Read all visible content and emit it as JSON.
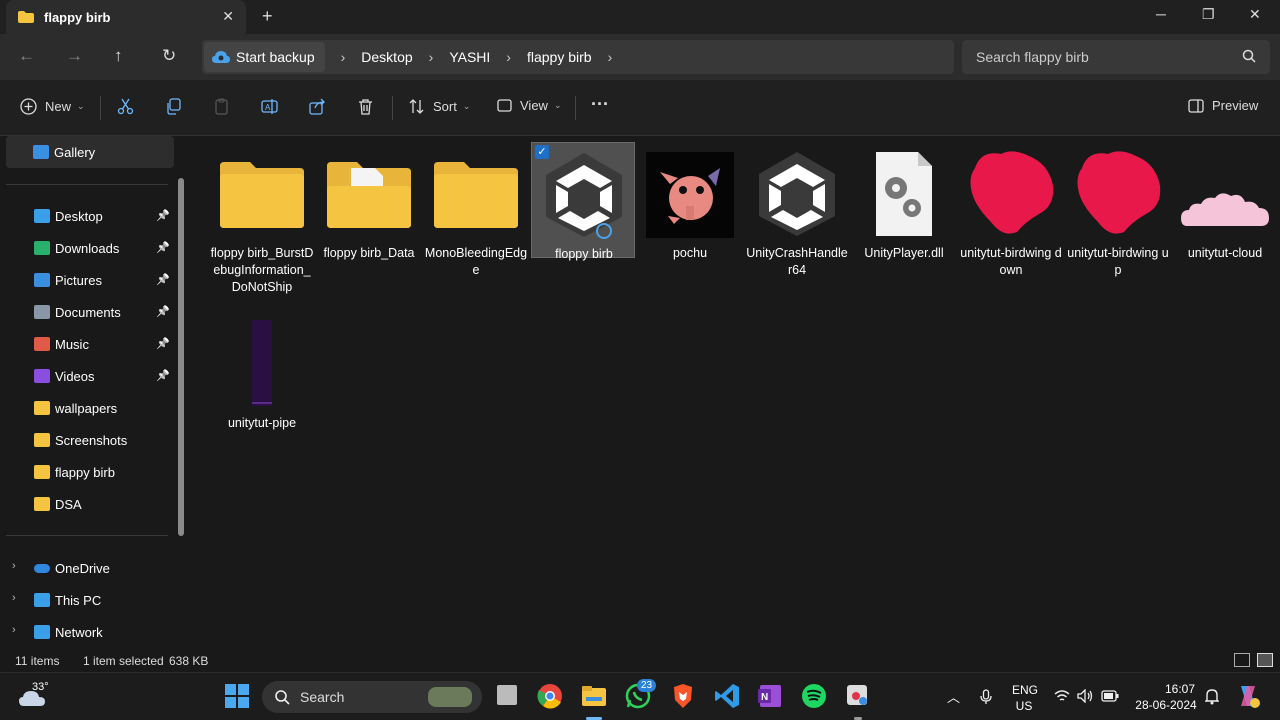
{
  "window": {
    "tab_title": "flappy birb",
    "tab_close": "✕",
    "new_tab": "+",
    "minimize": "─",
    "maximize": "❐",
    "close": "✕"
  },
  "address": {
    "backup_label": "Start backup",
    "crumbs": [
      "Desktop",
      "YASHI",
      "flappy birb"
    ],
    "separator": "›",
    "search_placeholder": "Search flappy birb"
  },
  "toolbar": {
    "new_label": "New",
    "sort_label": "Sort",
    "view_label": "View",
    "more_label": "···",
    "preview_label": "Preview"
  },
  "sidebar": {
    "gallery": "Gallery",
    "quick": [
      {
        "label": "Desktop",
        "pinned": true,
        "color": "#3aa0e8"
      },
      {
        "label": "Downloads",
        "pinned": true,
        "color": "#29b06a"
      },
      {
        "label": "Pictures",
        "pinned": true,
        "color": "#3b8fe0"
      },
      {
        "label": "Documents",
        "pinned": true,
        "color": "#8a97a8"
      },
      {
        "label": "Music",
        "pinned": true,
        "color": "#e05a4a"
      },
      {
        "label": "Videos",
        "pinned": true,
        "color": "#8a4fe0"
      },
      {
        "label": "wallpapers",
        "pinned": false,
        "color": "#f5c542"
      },
      {
        "label": "Screenshots",
        "pinned": false,
        "color": "#f5c542"
      },
      {
        "label": "flappy birb",
        "pinned": false,
        "color": "#f5c542"
      },
      {
        "label": "DSA",
        "pinned": false,
        "color": "#f5c542"
      }
    ],
    "locations": [
      "OneDrive",
      "This PC",
      "Network"
    ],
    "pin_glyph": "📌",
    "expand_glyph": "›"
  },
  "files": [
    {
      "name": "floppy birb_BurstDebugInformation_DoNotShip",
      "kind": "folder"
    },
    {
      "name": "floppy birb_Data",
      "kind": "folder-doc"
    },
    {
      "name": "MonoBleedingEdge",
      "kind": "folder"
    },
    {
      "name": "floppy birb",
      "kind": "unity",
      "selected": true
    },
    {
      "name": "pochu",
      "kind": "image-pochu"
    },
    {
      "name": "UnityCrashHandler64",
      "kind": "unity"
    },
    {
      "name": "UnityPlayer.dll",
      "kind": "dll"
    },
    {
      "name": "unitytut-birdwing down",
      "kind": "bird"
    },
    {
      "name": "unitytut-birdwing up",
      "kind": "bird"
    },
    {
      "name": "unitytut-cloud",
      "kind": "cloud"
    },
    {
      "name": "unitytut-pipe",
      "kind": "pipe"
    }
  ],
  "status": {
    "items_count": "11 items",
    "selection": "1 item selected",
    "size": "638 KB"
  },
  "taskbar": {
    "weather_temp": "33°",
    "search_label": "Search",
    "whatsapp_badge": "23",
    "lang": "ENG",
    "region": "US",
    "time": "16:07",
    "date": "28-06-2024"
  },
  "colors": {
    "accent": "#1f6fc8",
    "folder": "#f5c542",
    "bird": "#e8194a",
    "cloud": "#f6c4d8",
    "pipe": "#2a0f45"
  }
}
